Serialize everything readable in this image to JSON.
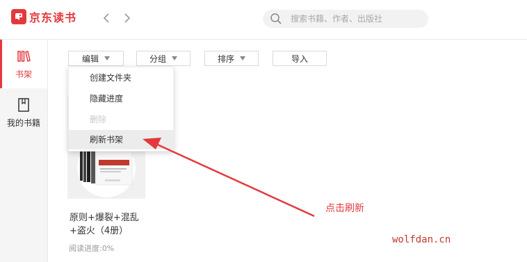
{
  "app": {
    "logo_text": "京东读书"
  },
  "search": {
    "placeholder": "搜索书籍、作者、出版社"
  },
  "sidebar": {
    "items": [
      {
        "label": "书架",
        "icon": "bookshelf-icon",
        "active": true
      },
      {
        "label": "我的书籍",
        "icon": "bookmark-book-icon",
        "active": false
      }
    ]
  },
  "toolbar": {
    "edit_label": "编辑",
    "group_label": "分组",
    "sort_label": "排序",
    "import_label": "导入"
  },
  "edit_menu": {
    "items": [
      {
        "label": "创建文件夹",
        "enabled": true
      },
      {
        "label": "隐藏进度",
        "enabled": true
      },
      {
        "label": "删除",
        "enabled": false
      },
      {
        "label": "刷新书架",
        "enabled": true,
        "highlighted": true
      }
    ]
  },
  "book": {
    "title": "原则+爆裂+混乱+盗火（4册）",
    "progress": "阅读进度:0%"
  },
  "annotation": {
    "text": "点击刷新"
  },
  "watermark": "wolfdan.cn",
  "colors": {
    "brand": "#e4393c",
    "annotation_arrow": "#e4393c"
  }
}
